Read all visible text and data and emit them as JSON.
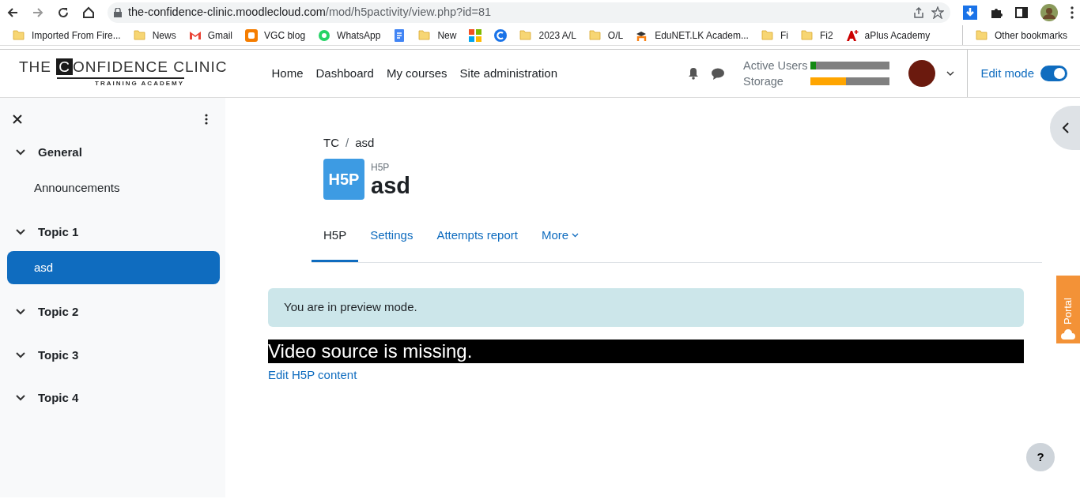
{
  "browser": {
    "url_host": "the-confidence-clinic.moodlecloud.com",
    "url_path": "/mod/h5pactivity/view.php?id=81"
  },
  "bookmarks": [
    {
      "kind": "folder",
      "label": "Imported From Fire..."
    },
    {
      "kind": "folder",
      "label": "News"
    },
    {
      "kind": "gmail",
      "label": "Gmail"
    },
    {
      "kind": "blogger",
      "label": "VGC blog"
    },
    {
      "kind": "whatsapp",
      "label": "WhatsApp"
    },
    {
      "kind": "docs"
    },
    {
      "kind": "folder",
      "label": "New"
    },
    {
      "kind": "microsoft"
    },
    {
      "kind": "c"
    },
    {
      "kind": "folder",
      "label": "2023 A/L"
    },
    {
      "kind": "folder",
      "label": "O/L"
    },
    {
      "kind": "moodle",
      "label": "EduNET.LK Academ..."
    },
    {
      "kind": "folder",
      "label": "Fi"
    },
    {
      "kind": "folder",
      "label": "Fi2"
    },
    {
      "kind": "aplus",
      "label": "aPlus Academy"
    }
  ],
  "other_bookmarks": "Other bookmarks",
  "logo": {
    "before": "THE",
    "boxed": "C",
    "after": "ONFIDENCE CLINIC",
    "tagline": "TRAINING ACADEMY"
  },
  "nav": [
    "Home",
    "Dashboard",
    "My courses",
    "Site administration"
  ],
  "meters": [
    {
      "label": "Active Users",
      "level": 0.07,
      "color": "#138a13"
    },
    {
      "label": "Storage",
      "level": 0.45,
      "color": "#ffa500"
    }
  ],
  "edit_mode": {
    "label": "Edit mode",
    "on": true
  },
  "sidebar": {
    "items": [
      {
        "label": "General",
        "expanded": true,
        "children": [
          {
            "label": "Announcements",
            "selected": false
          }
        ]
      },
      {
        "label": "Topic 1",
        "expanded": true,
        "children": [
          {
            "label": "asd",
            "selected": true
          }
        ]
      },
      {
        "label": "Topic 2",
        "expanded": true
      },
      {
        "label": "Topic 3",
        "expanded": true
      },
      {
        "label": "Topic 4",
        "expanded": true
      }
    ]
  },
  "breadcrumb": {
    "items": [
      "TC",
      "asd"
    ],
    "separator": "/"
  },
  "activity": {
    "icon_text": "H5P",
    "type": "H5P",
    "title": "asd"
  },
  "tabs": [
    {
      "label": "H5P",
      "kind": "tab",
      "selected": true
    },
    {
      "label": "Settings",
      "kind": "tab",
      "selected": false
    },
    {
      "label": "Attempts report",
      "kind": "tab",
      "selected": false
    },
    {
      "label": "More",
      "kind": "dropdown",
      "selected": false
    }
  ],
  "alert": "You are in preview mode.",
  "video_message": "Video source is missing.",
  "edit_link": "Edit H5P content",
  "portal": "Portal",
  "help": "?"
}
